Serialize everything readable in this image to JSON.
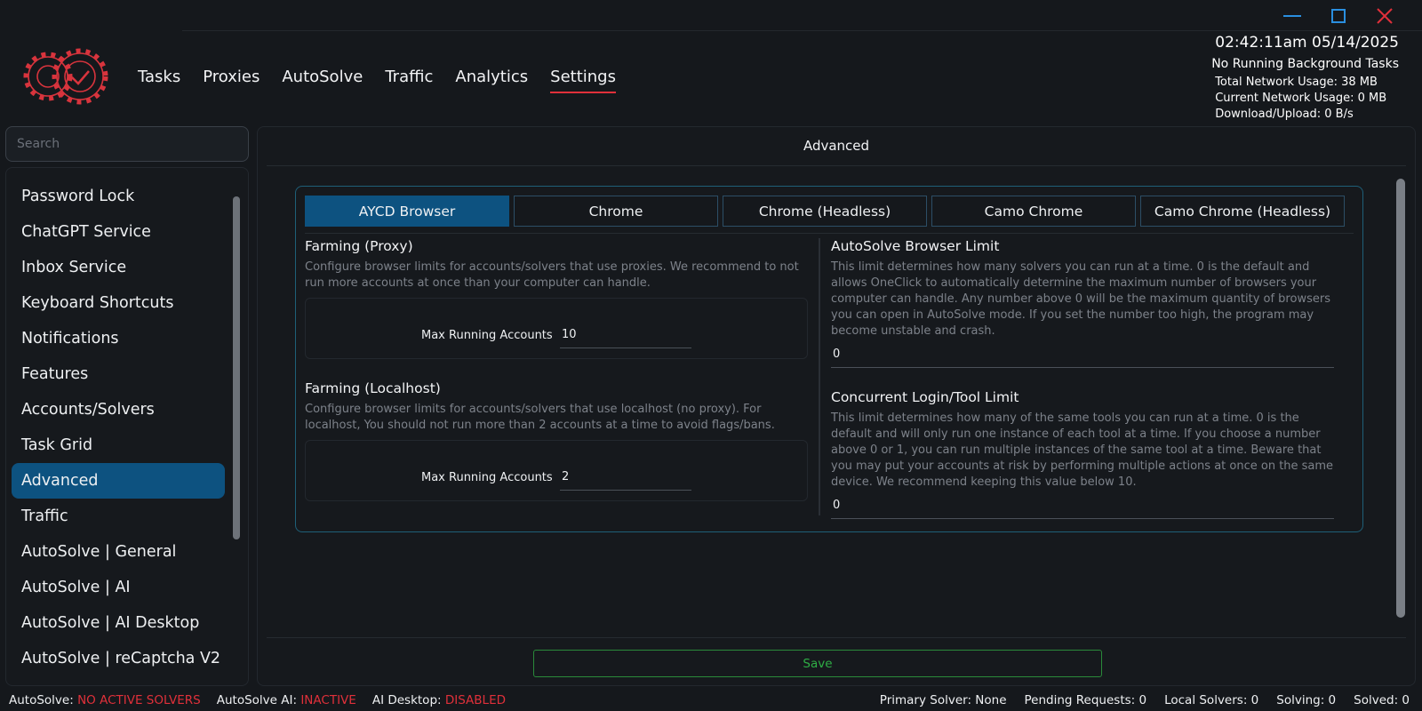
{
  "colors": {
    "accent_blue": "#0d5280",
    "accent_red": "#e0303a",
    "save_green": "#2fae45"
  },
  "window_controls": {
    "minimize_icon": "minimize-icon",
    "maximize_icon": "maximize-icon",
    "close_icon": "close-icon"
  },
  "nav": {
    "items": [
      "Tasks",
      "Proxies",
      "AutoSolve",
      "Traffic",
      "Analytics",
      "Settings"
    ],
    "active": "Settings"
  },
  "status": {
    "clock": "02:42:11am 05/14/2025",
    "background_tasks": "No Running Background Tasks",
    "total_network": "Total Network Usage:  38 MB",
    "current_network": "Current Network Usage: 0 MB",
    "download_upload": "Download/Upload: 0 B/s"
  },
  "search": {
    "placeholder": "Search",
    "value": ""
  },
  "sidebar": {
    "items": [
      "Password Lock",
      "ChatGPT Service",
      "Inbox Service",
      "Keyboard Shortcuts",
      "Notifications",
      "Features",
      "Accounts/Solvers",
      "Task Grid",
      "Advanced",
      "Traffic",
      "AutoSolve | General",
      "AutoSolve | AI",
      "AutoSolve | AI Desktop",
      "AutoSolve | reCaptcha V2"
    ],
    "active": "Advanced"
  },
  "main": {
    "title": "Advanced",
    "tabs": [
      "AYCD Browser",
      "Chrome",
      "Chrome (Headless)",
      "Camo Chrome",
      "Camo Chrome (Headless)"
    ],
    "active_tab": "AYCD Browser",
    "farming_proxy": {
      "title": "Farming (Proxy)",
      "desc": "Configure browser limits for accounts/solvers that use proxies. We recommend to not run more accounts at once than your computer can handle.",
      "field_label": "Max Running Accounts",
      "field_value": "10"
    },
    "farming_localhost": {
      "title": "Farming (Localhost)",
      "desc": "Configure browser limits for accounts/solvers that use localhost (no proxy). For localhost, You should not run more than 2 accounts at a time to avoid flags/bans.",
      "field_label": "Max Running Accounts",
      "field_value": "2"
    },
    "autosolve_limit": {
      "title": "AutoSolve Browser Limit",
      "desc": "This limit determines how many solvers you can run at a time. 0 is the default and allows OneClick to automatically determine the maximum number of browsers your computer can handle. Any number above 0 will be the maximum quantity of browsers you can open in AutoSolve mode. If you set the number too high, the program may become unstable and crash.",
      "value": "0"
    },
    "concurrent_limit": {
      "title": "Concurrent Login/Tool Limit",
      "desc": "This limit determines how many of the same tools you can run at a time. 0 is the default and will only run one instance of each tool at a time. If you choose a number above 0 or 1, you can run multiple instances of the same tool at a time. Beware that you may put your accounts at risk by performing multiple actions at once on the same device. We recommend keeping this value below 10.",
      "value": "0"
    },
    "save_label": "Save"
  },
  "statusbar": {
    "autosolve_label": "AutoSolve:",
    "autosolve_value": "NO ACTIVE SOLVERS",
    "autosolve_ai_label": "AutoSolve AI:",
    "autosolve_ai_value": "INACTIVE",
    "ai_desktop_label": "AI Desktop:",
    "ai_desktop_value": "DISABLED",
    "primary_solver": "Primary Solver: None",
    "pending_requests": "Pending Requests: 0",
    "local_solvers": "Local Solvers: 0",
    "solving": "Solving: 0",
    "solved": "Solved: 0"
  }
}
